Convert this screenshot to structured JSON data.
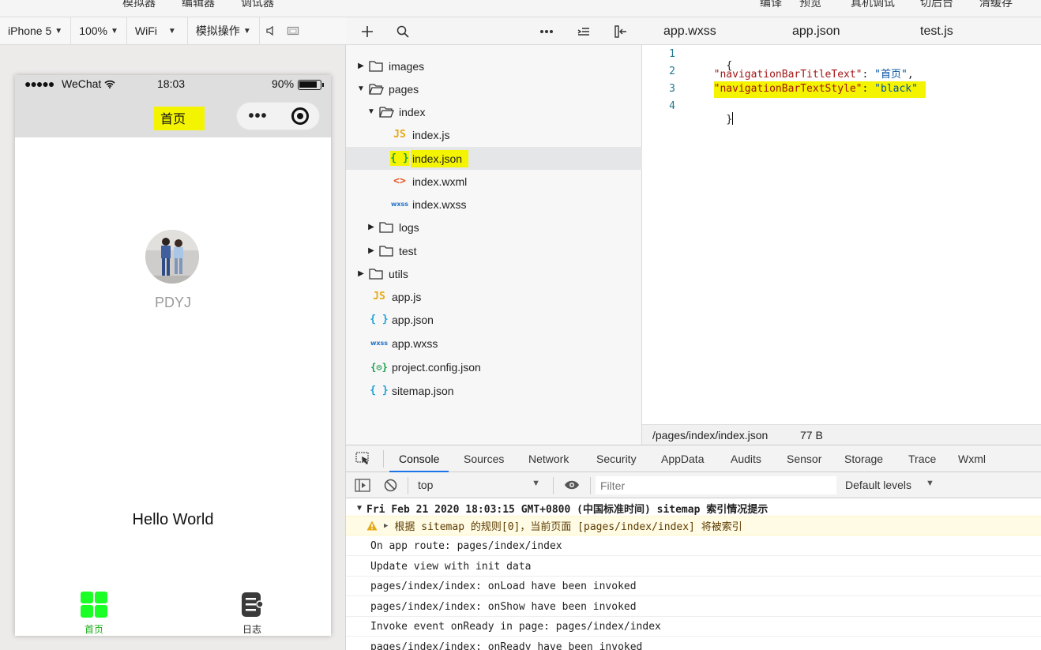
{
  "topbar": {
    "left": [
      "模拟器",
      "编辑器",
      "调试器"
    ],
    "right": [
      "编译",
      "预览",
      "真机调试",
      "切后台",
      "清缓存"
    ]
  },
  "simulator_toolbar": {
    "device": "iPhone 5",
    "zoom": "100%",
    "network": "WiFi",
    "operation": "模拟操作",
    "icons": [
      "volume-icon",
      "window-icon"
    ]
  },
  "phone": {
    "status": {
      "signal": "●●●●●",
      "carrier": "WeChat",
      "time": "18:03",
      "battery": "90%"
    },
    "nav_title": "首页",
    "capsule": {
      "more": "•••"
    },
    "nickname": "PDYJ",
    "hello": "Hello World",
    "tabs": [
      {
        "label": "首页",
        "color": "#1aad19",
        "active": true
      },
      {
        "label": "日志",
        "color": "#333333",
        "active": false
      }
    ]
  },
  "explorer": {
    "toolbar_icons": [
      "add-icon",
      "search-icon",
      "more-icon",
      "collapse-icon",
      "split-icon"
    ],
    "tree": [
      {
        "label": "images",
        "type": "folder",
        "open": false,
        "depth": 0
      },
      {
        "label": "pages",
        "type": "folder",
        "open": true,
        "depth": 0
      },
      {
        "label": "index",
        "type": "folder",
        "open": true,
        "depth": 1
      },
      {
        "label": "index.js",
        "type": "js",
        "depth": 2
      },
      {
        "label": "index.json",
        "type": "json-green",
        "depth": 2,
        "selected": true,
        "highlighted": true
      },
      {
        "label": "index.wxml",
        "type": "wxml",
        "depth": 2
      },
      {
        "label": "index.wxss",
        "type": "wxss",
        "depth": 2
      },
      {
        "label": "logs",
        "type": "folder",
        "open": false,
        "depth": 1
      },
      {
        "label": "test",
        "type": "folder",
        "open": false,
        "depth": 1
      },
      {
        "label": "utils",
        "type": "folder",
        "open": false,
        "depth": 0
      },
      {
        "label": "app.js",
        "type": "js",
        "depth": 0
      },
      {
        "label": "app.json",
        "type": "json",
        "depth": 0
      },
      {
        "label": "app.wxss",
        "type": "wxss",
        "depth": 0
      },
      {
        "label": "project.config.json",
        "type": "config",
        "depth": 0
      },
      {
        "label": "sitemap.json",
        "type": "json",
        "depth": 0
      }
    ]
  },
  "editor": {
    "tabs": [
      "app.wxss",
      "app.json",
      "test.js"
    ],
    "lines": [
      {
        "num": "1",
        "tokens": [
          {
            "t": "{",
            "c": "p"
          }
        ]
      },
      {
        "num": "2",
        "tokens": [
          {
            "t": "  ",
            "c": "p"
          },
          {
            "t": "\"navigationBarTitleText\"",
            "c": "k"
          },
          {
            "t": ": ",
            "c": "p"
          },
          {
            "t": "\"首页\"",
            "c": "s"
          },
          {
            "t": ",",
            "c": "p"
          }
        ]
      },
      {
        "num": "3",
        "tokens": [
          {
            "t": "  ",
            "c": "p"
          },
          {
            "t": "\"navigationBarTextStyle\"",
            "c": "k"
          },
          {
            "t": ": ",
            "c": "p"
          },
          {
            "t": "\"black\"",
            "c": "s"
          }
        ],
        "highlighted": true
      },
      {
        "num": "4",
        "tokens": [
          {
            "t": "}",
            "c": "p"
          }
        ]
      }
    ],
    "status_path": "/pages/index/index.json",
    "status_size": "77 B"
  },
  "devtools": {
    "tabs": [
      "Console",
      "Sources",
      "Network",
      "Security",
      "AppData",
      "Audits",
      "Sensor",
      "Storage",
      "Trace",
      "Wxml"
    ],
    "active_tab": "Console",
    "context": "top",
    "filter_placeholder": "Filter",
    "levels": "Default levels",
    "console": {
      "group_header": "Fri Feb 21 2020 18:03:15 GMT+0800 (中国标准时间) sitemap 索引情况提示",
      "warning": "根据 sitemap 的规则[0]，当前页面 [pages/index/index] 将被索引",
      "lines": [
        "On app route: pages/index/index",
        "Update view with init data",
        "pages/index/index: onLoad have been invoked",
        "pages/index/index: onShow have been invoked",
        "Invoke event onReady in page: pages/index/index",
        "pages/index/index: onReady have been invoked"
      ]
    }
  },
  "colors": {
    "highlight": "#f4f400",
    "tab_active": "#1aad19",
    "devtools_accent": "#1a73e8",
    "warning": "#e6a817"
  }
}
